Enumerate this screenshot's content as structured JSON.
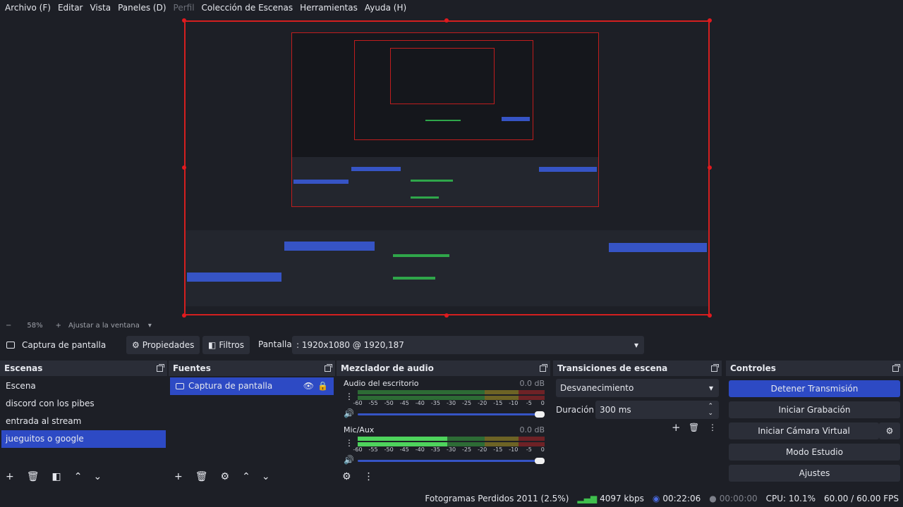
{
  "menu": {
    "items": [
      {
        "label": "Archivo (F)",
        "disabled": false
      },
      {
        "label": "Editar",
        "disabled": false
      },
      {
        "label": "Vista",
        "disabled": false
      },
      {
        "label": "Paneles (D)",
        "disabled": false
      },
      {
        "label": "Perfil",
        "disabled": true
      },
      {
        "label": "Colección de Escenas",
        "disabled": false
      },
      {
        "label": "Herramientas",
        "disabled": false
      },
      {
        "label": "Ayuda (H)",
        "disabled": false
      }
    ]
  },
  "zoom": {
    "minus": "−",
    "value": "58%",
    "plus": "+",
    "fit": "Ajustar a la ventana"
  },
  "source_toolbar": {
    "source_name": "Captura de pantalla",
    "properties": "Propiedades",
    "filters": "Filtros",
    "screen_label": "Pantalla",
    "screen_value": ": 1920x1080 @ 1920,187"
  },
  "scenes": {
    "title": "Escenas",
    "items": [
      "Escena",
      "discord con los pibes",
      "entrada al stream",
      "jueguitos o google"
    ],
    "selected_index": 3
  },
  "sources": {
    "title": "Fuentes",
    "items": [
      "Captura de pantalla"
    ]
  },
  "mixer": {
    "title": "Mezclador de audio",
    "channels": [
      {
        "name": "Audio del escritorio",
        "db": "0.0 dB",
        "level": 0.0
      },
      {
        "name": "Mic/Aux",
        "db": "0.0 dB",
        "level": 0.48
      }
    ],
    "ticks": [
      "-60",
      "-55",
      "-50",
      "-45",
      "-40",
      "-35",
      "-30",
      "-25",
      "-20",
      "-15",
      "-10",
      "-5",
      "0"
    ]
  },
  "transitions": {
    "title": "Transiciones de escena",
    "selected": "Desvanecimiento",
    "duration_label": "Duración",
    "duration_value": "300 ms"
  },
  "controls": {
    "title": "Controles",
    "stop_stream": "Detener Transmisión",
    "start_recording": "Iniciar Grabación",
    "start_virtual_cam": "Iniciar Cámara Virtual",
    "studio_mode": "Modo Estudio",
    "settings": "Ajustes"
  },
  "status": {
    "dropped_frames": "Fotogramas Perdidos 2011 (2.5%)",
    "bitrate": "4097 kbps",
    "stream_time": "00:22:06",
    "rec_time": "00:00:00",
    "cpu": "CPU: 10.1%",
    "fps": "60.00 / 60.00 FPS"
  },
  "colors": {
    "accent": "#2d4ac4",
    "selection_border": "#d41f1f",
    "background": "#1d1f26",
    "panel_title": "#2a2d37"
  }
}
